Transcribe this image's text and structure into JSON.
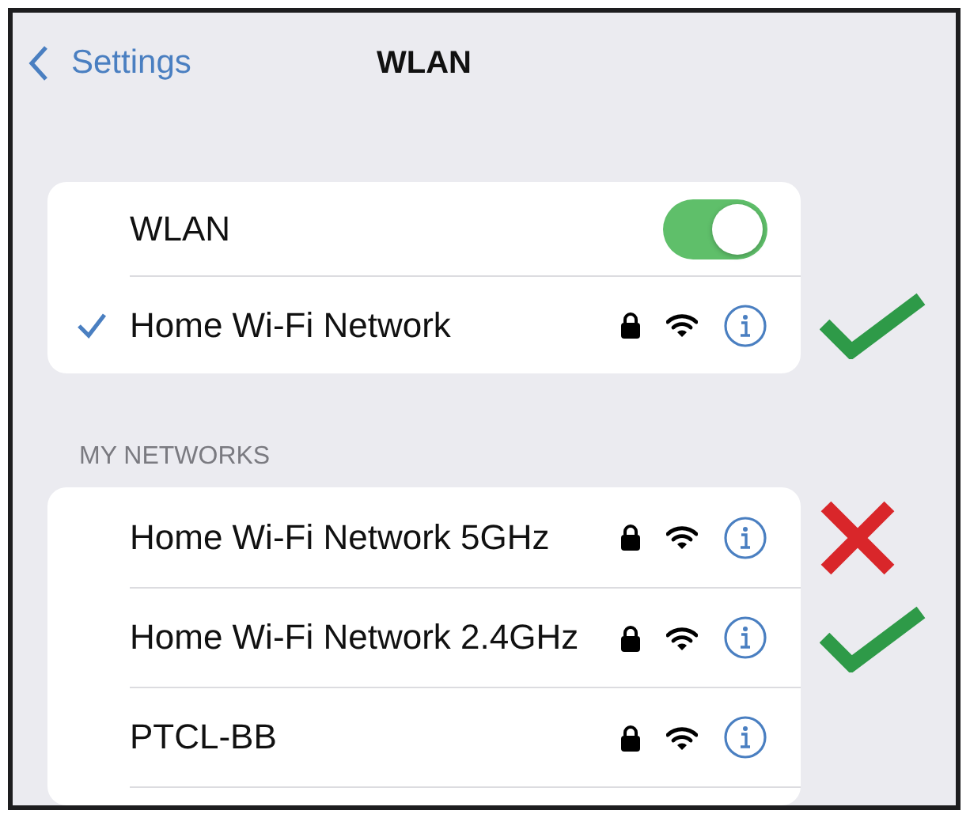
{
  "nav": {
    "back": "Settings",
    "title": "WLAN"
  },
  "wlan": {
    "label": "WLAN",
    "on": true
  },
  "current": {
    "name": "Home Wi-Fi Network",
    "connected": true,
    "locked": true,
    "annotation": {
      "kind": "check"
    }
  },
  "section": "MY NETWORKS",
  "networks": [
    {
      "name": "Home Wi-Fi Network 5GHz",
      "locked": true,
      "annotation": {
        "kind": "cross"
      }
    },
    {
      "name": "Home Wi-Fi Network 2.4GHz",
      "locked": true,
      "annotation": {
        "kind": "check"
      }
    },
    {
      "name": "PTCL-BB",
      "locked": true
    }
  ]
}
